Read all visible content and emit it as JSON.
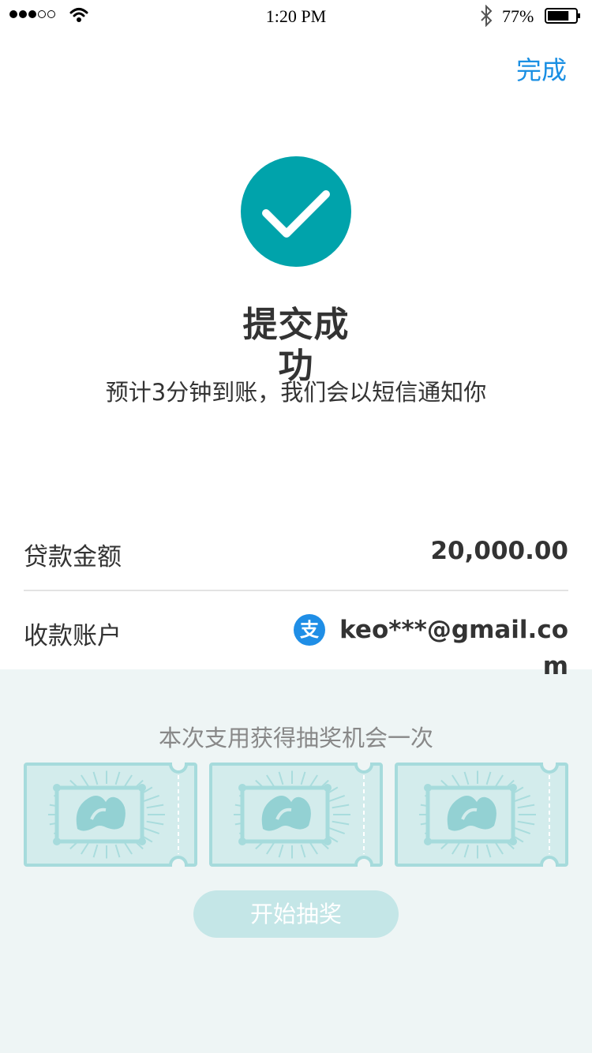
{
  "status_bar": {
    "time": "1:20 PM",
    "battery_percent": "77%",
    "battery_level": 0.77,
    "signal_bars": 3,
    "signal_total": 5
  },
  "header": {
    "done_label": "完成"
  },
  "result": {
    "title_line1": "提交成",
    "title_line2": "功",
    "subtitle": "预计3分钟到账，我们会以短信通知你",
    "accent_color": "#00a3ab"
  },
  "details": {
    "amount_label": "贷款金额",
    "amount_value": "20,000.00",
    "account_label": "收款账户",
    "account_icon": "alipay-icon",
    "account_icon_glyph": "支",
    "account_value_line1": "keo***@gmail.co",
    "account_value_line2": "m"
  },
  "lottery": {
    "caption": "本次支用获得抽奖机会一次",
    "ticket_count": 3,
    "draw_button_label": "开始抽奖"
  }
}
